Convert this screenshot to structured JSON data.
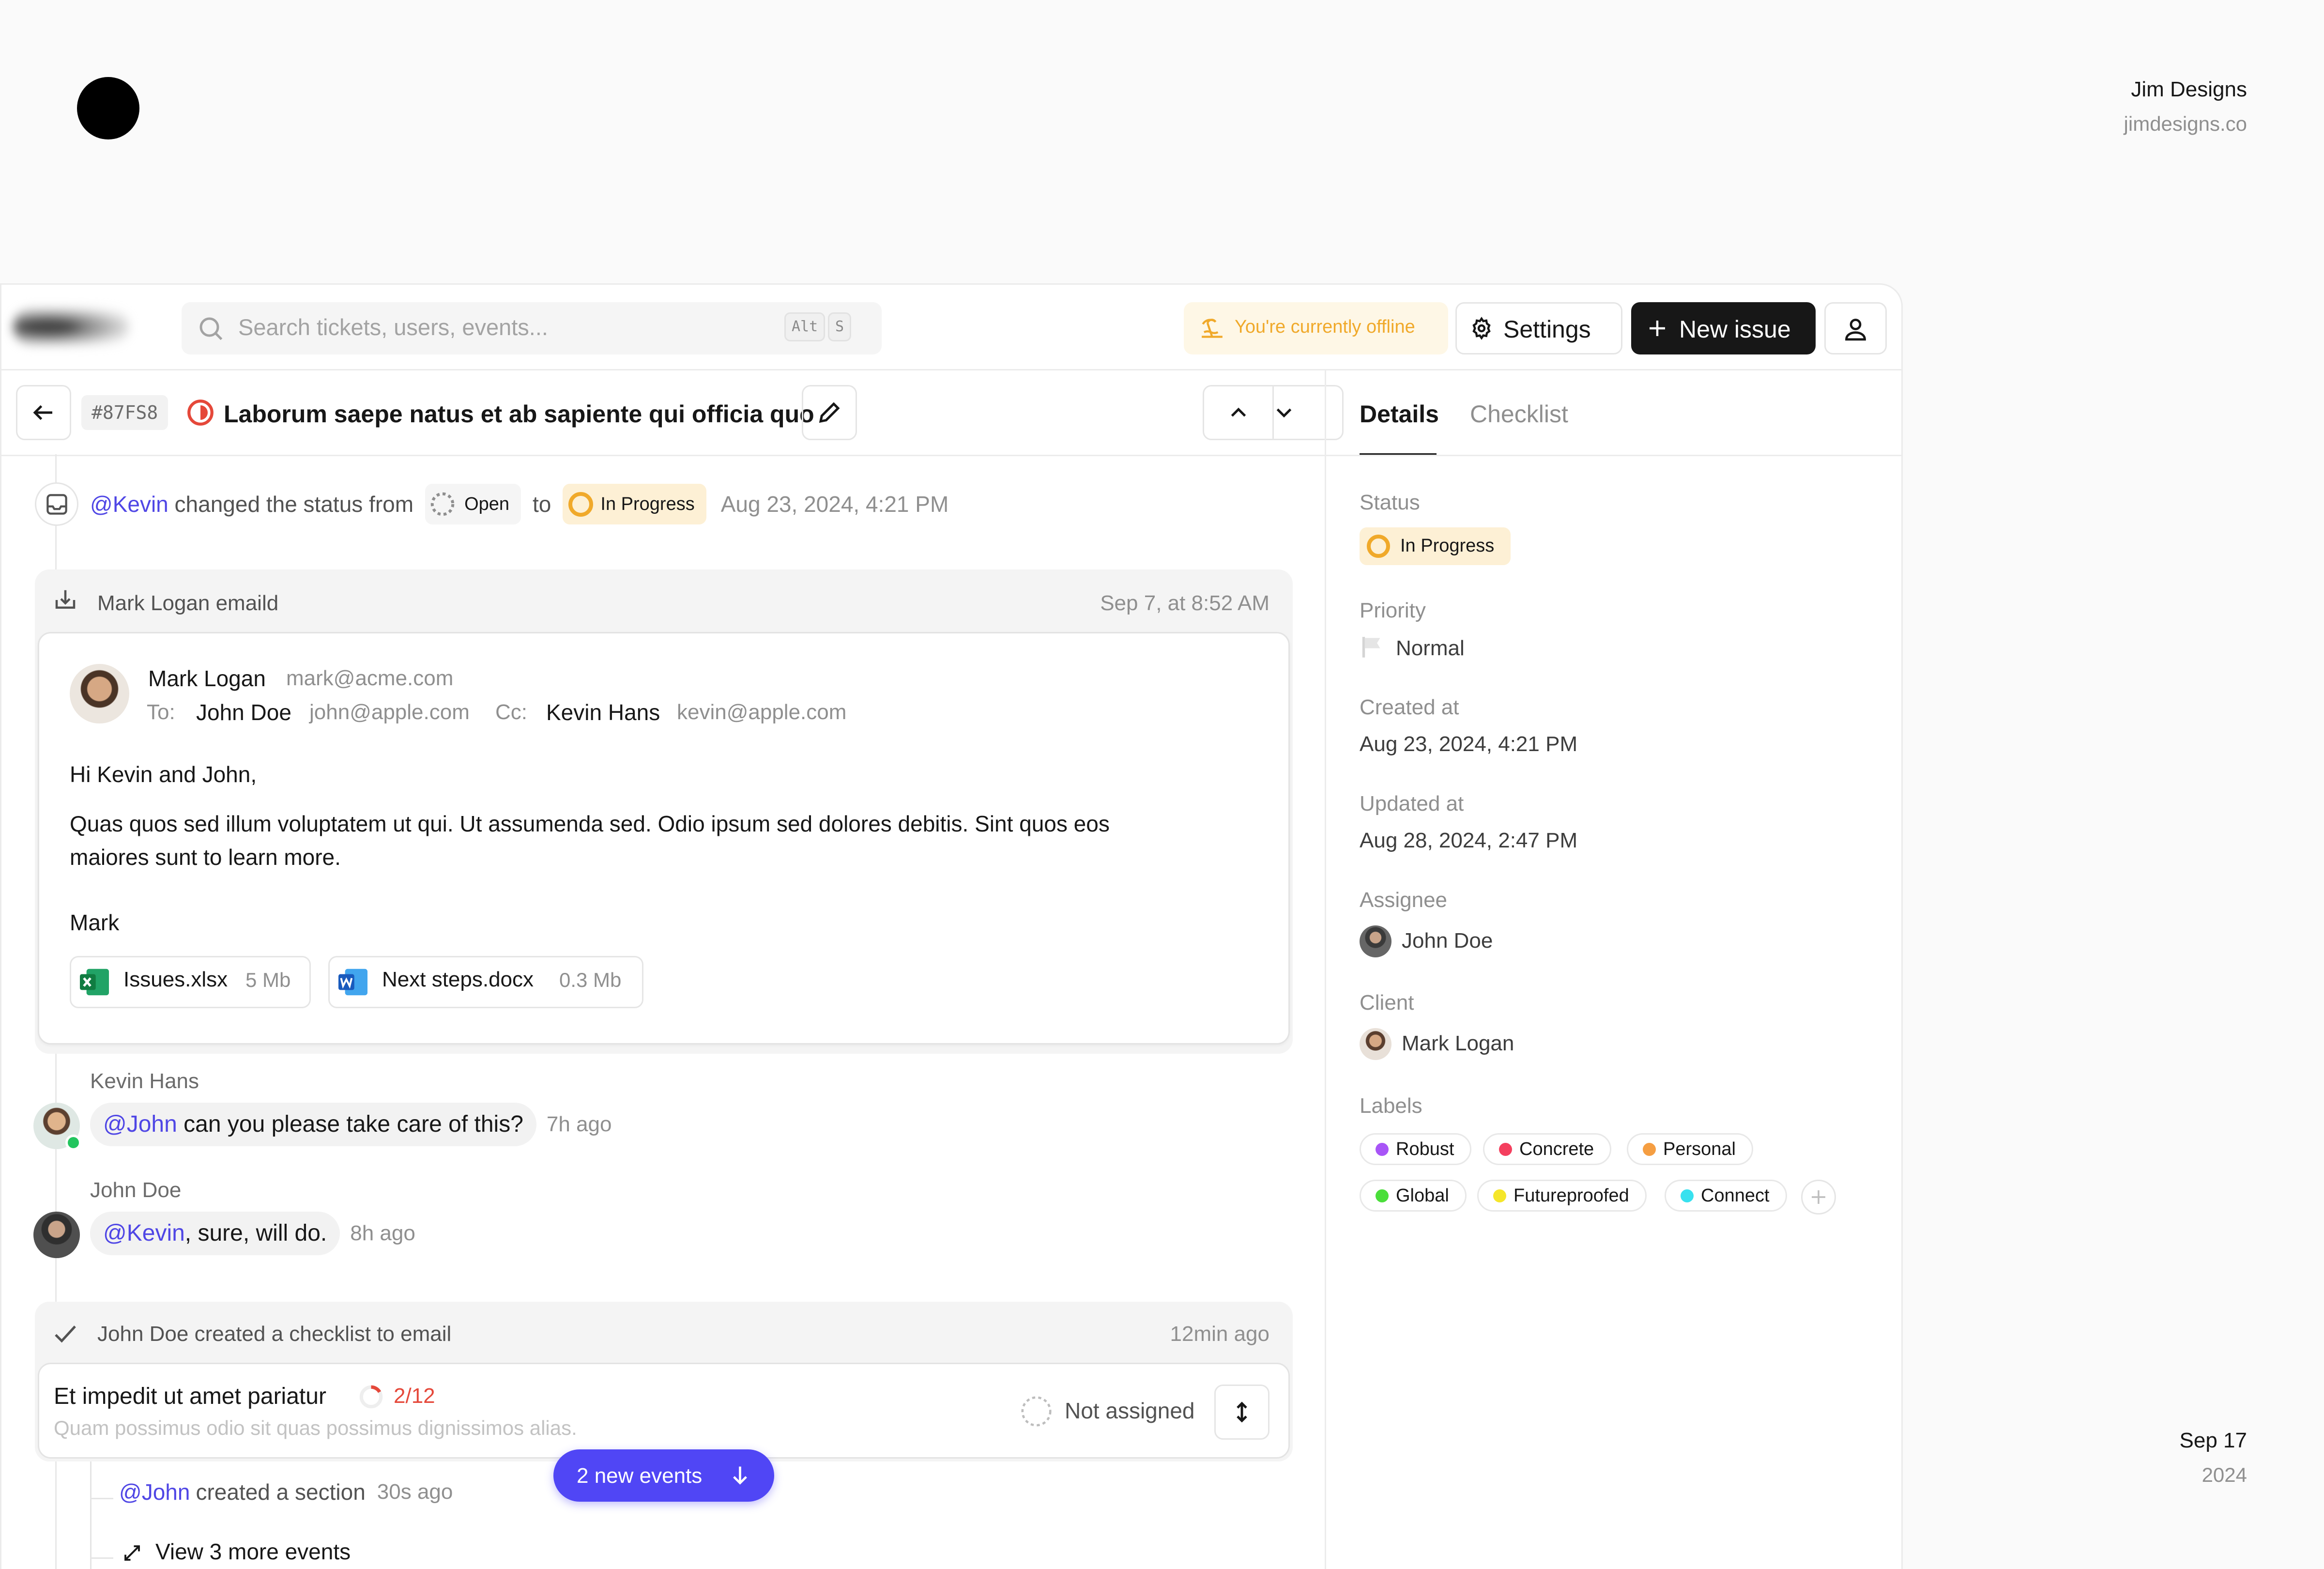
{
  "brand": {
    "name": "Jim Designs",
    "url": "jimdesigns.co"
  },
  "footer": {
    "date": "Sep 17",
    "year": "2024"
  },
  "topbar": {
    "search_placeholder": "Search tickets, users, events...",
    "shortcut_keys": [
      "Alt",
      "S"
    ],
    "offline_text": "You're currently offline",
    "settings_label": "Settings",
    "new_issue_label": "New issue"
  },
  "issue": {
    "id": "#87FS8",
    "title": "Laborum saepe natus et ab sapiente qui officia quo"
  },
  "tabs": {
    "details": "Details",
    "checklist": "Checklist"
  },
  "details": {
    "status_label": "Status",
    "status_value": "In Progress",
    "priority_label": "Priority",
    "priority_value": "Normal",
    "created_label": "Created at",
    "created_value": "Aug 23, 2024, 4:21 PM",
    "updated_label": "Updated at",
    "updated_value": "Aug 28, 2024, 2:47 PM",
    "assignee_label": "Assignee",
    "assignee_value": "John Doe",
    "client_label": "Client",
    "client_value": "Mark Logan",
    "labels_label": "Labels",
    "labels": [
      {
        "name": "Robust",
        "color": "#a855f7"
      },
      {
        "name": "Concrete",
        "color": "#f43f5e"
      },
      {
        "name": "Personal",
        "color": "#f59e42"
      },
      {
        "name": "Global",
        "color": "#4ade3a"
      },
      {
        "name": "Futureproofed",
        "color": "#f5e62a"
      },
      {
        "name": "Connect",
        "color": "#38e1ef"
      }
    ]
  },
  "status_event": {
    "actor": "@Kevin",
    "text": "changed the status from",
    "from": "Open",
    "to_word": "to",
    "to": "In Progress",
    "time": "Aug 23, 2024, 4:21 PM"
  },
  "email": {
    "header_title": "Mark Logan emaild",
    "header_time": "Sep 7, at 8:52 AM",
    "from_name": "Mark Logan",
    "from_email": "mark@acme.com",
    "to_label": "To:",
    "to_name": "John Doe",
    "to_email": "john@apple.com",
    "cc_label": "Cc:",
    "cc_name": "Kevin Hans",
    "cc_email": "kevin@apple.com",
    "greeting": "Hi Kevin and John,",
    "body_line1": "Quas quos sed illum voluptatem ut qui. Ut assumenda sed. Odio ipsum sed dolores debitis. Sint quos eos",
    "body_line2": "maiores sunt to learn more.",
    "signature": "Mark",
    "attachments": [
      {
        "name": "Issues.xlsx",
        "size": "5 Mb"
      },
      {
        "name": "Next steps.docx",
        "size": "0.3 Mb"
      }
    ]
  },
  "comments": [
    {
      "author": "Kevin Hans",
      "mention": "@John",
      "text": " can you please take care of this?",
      "time": "7h ago"
    },
    {
      "author": "John Doe",
      "mention": "@Kevin",
      "text": ", sure, will do.",
      "time": "8h ago"
    }
  ],
  "checklist_event": {
    "header": "John Doe created a checklist to email",
    "time": "12min ago",
    "title": "Et impedit ut amet pariatur",
    "progress": "2/12",
    "progress_fraction": 0.167,
    "subtitle": "Quam possimus odio sit quas possimus dignissimos alias.",
    "assign_label": "Not assigned"
  },
  "section_event": {
    "actor": "@John",
    "text": "created a section",
    "time": "30s ago"
  },
  "more_events": "View 3 more events",
  "new_events_label": "2 new events"
}
